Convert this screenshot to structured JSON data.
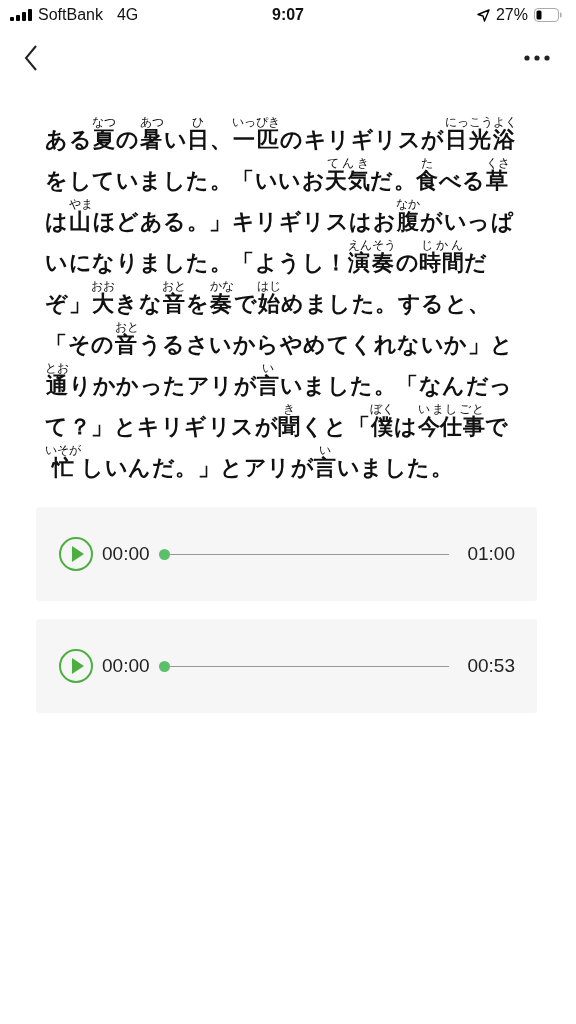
{
  "status_bar": {
    "carrier": "SoftBank",
    "network": "4G",
    "time": "9:07",
    "battery": "27%"
  },
  "story_lines": [
    [
      {
        "t": "ある"
      },
      {
        "t": "夏",
        "r": "なつ"
      },
      {
        "t": "の"
      },
      {
        "t": "暑",
        "r": "あつ"
      },
      {
        "t": "い"
      },
      {
        "t": "日",
        "r": "ひ"
      },
      {
        "t": "、"
      },
      {
        "t": "一匹",
        "r": "いっぴき"
      },
      {
        "t": "のキリギリスが"
      },
      {
        "t": "日光浴",
        "r": "にっこうよく"
      }
    ],
    [
      {
        "t": "をしていました。「いいお"
      },
      {
        "t": "天気",
        "r": "てんき"
      },
      {
        "t": "だ。"
      },
      {
        "t": "食",
        "r": "た"
      },
      {
        "t": "べる"
      },
      {
        "t": "草",
        "r": "くさ"
      }
    ],
    [
      {
        "t": "は"
      },
      {
        "t": "山",
        "r": "やま"
      },
      {
        "t": "ほどある。」キリギリスはお"
      },
      {
        "t": "腹",
        "r": "なか"
      },
      {
        "t": "がいっぱ"
      }
    ],
    [
      {
        "t": "いになりました。「ようし！"
      },
      {
        "t": "演奏",
        "r": "えんそう"
      },
      {
        "t": "の"
      },
      {
        "t": "時間",
        "r": "じかん"
      },
      {
        "t": "だ"
      }
    ],
    [
      {
        "t": "ぞ」"
      },
      {
        "t": "大",
        "r": "おお"
      },
      {
        "t": "きな"
      },
      {
        "t": "音",
        "r": "おと"
      },
      {
        "t": "を"
      },
      {
        "t": "奏",
        "r": "かな"
      },
      {
        "t": "で"
      },
      {
        "t": "始",
        "r": "はじ"
      },
      {
        "t": "めました。すると、"
      }
    ],
    [
      {
        "t": "「その"
      },
      {
        "t": "音",
        "r": "おと"
      },
      {
        "t": "うるさいからやめてくれないか」と"
      }
    ],
    [
      {
        "t": "通",
        "r": "とお"
      },
      {
        "t": "りかかったアリが"
      },
      {
        "t": "言",
        "r": "い"
      },
      {
        "t": "いました。「なんだっ"
      }
    ],
    [
      {
        "t": "て？」とキリギリスが"
      },
      {
        "t": "聞",
        "r": "き"
      },
      {
        "t": "くと「"
      },
      {
        "t": "僕",
        "r": "ぼく"
      },
      {
        "t": "は"
      },
      {
        "t": "今仕事",
        "r": "いましごと"
      },
      {
        "t": "で"
      }
    ],
    [
      {
        "t": "忙",
        "r": "いそが"
      },
      {
        "t": "しいんだ。」とアリが"
      },
      {
        "t": "言",
        "r": "い"
      },
      {
        "t": "いました。"
      }
    ]
  ],
  "players": [
    {
      "current": "00:00",
      "duration": "01:00",
      "level": 0
    },
    {
      "current": "00:00",
      "duration": "00:53",
      "level": 0
    }
  ]
}
